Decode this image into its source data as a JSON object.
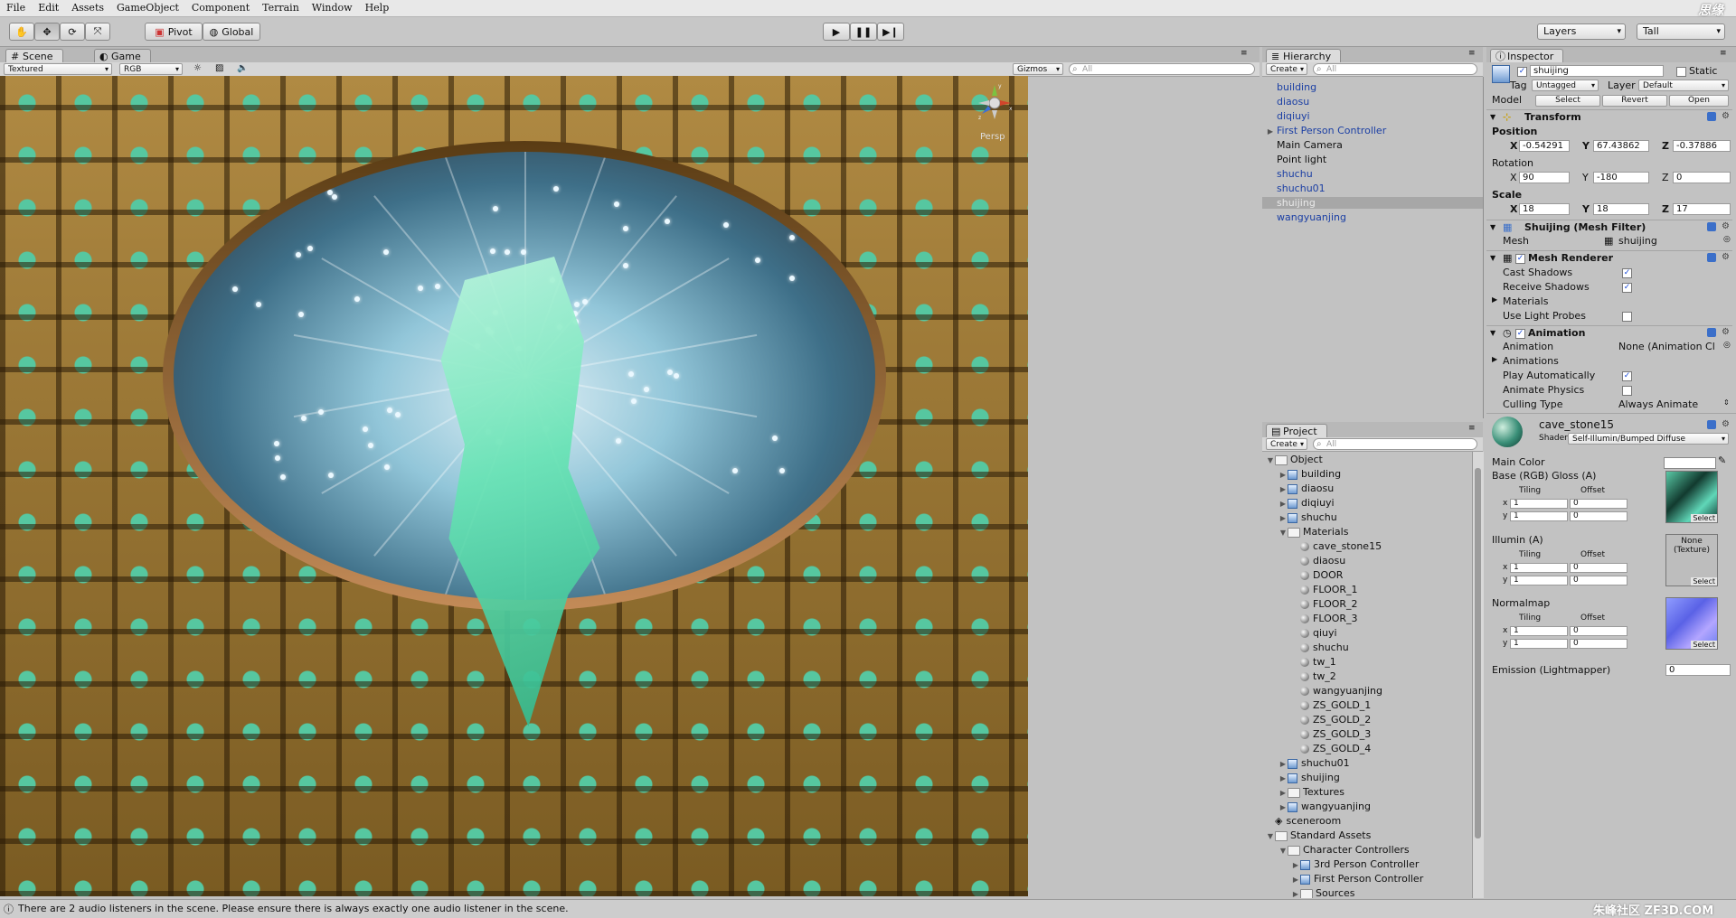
{
  "menubar": {
    "items": [
      "File",
      "Edit",
      "Assets",
      "GameObject",
      "Component",
      "Terrain",
      "Window",
      "Help"
    ],
    "watermark": "思缘"
  },
  "toolbar": {
    "pivot_label": "Pivot",
    "global_label": "Global",
    "layers_label": "Layers",
    "layout_label": "Tall"
  },
  "scene_panel": {
    "tab_scene": "Scene",
    "tab_game": "Game",
    "render_mode": "Textured",
    "color_mode": "RGB",
    "gizmos_label": "Gizmos",
    "search_placeholder": "All",
    "persp_label": "Persp",
    "gizmo_axis_y": "y",
    "gizmo_axis_x": "x",
    "gizmo_axis_z": "z"
  },
  "hierarchy": {
    "title": "Hierarchy",
    "create_label": "Create",
    "search_placeholder": "All",
    "items": [
      {
        "label": "building",
        "style": "blue",
        "expandable": false
      },
      {
        "label": "diaosu",
        "style": "blue",
        "expandable": false
      },
      {
        "label": "diqiuyi",
        "style": "blue",
        "expandable": false
      },
      {
        "label": "First Person Controller",
        "style": "blue",
        "expandable": true
      },
      {
        "label": "Main Camera",
        "style": "normal",
        "expandable": false
      },
      {
        "label": "Point light",
        "style": "normal",
        "expandable": false
      },
      {
        "label": "shuchu",
        "style": "blue",
        "expandable": false
      },
      {
        "label": "shuchu01",
        "style": "blue",
        "expandable": false
      },
      {
        "label": "shuijing",
        "style": "selected",
        "expandable": false
      },
      {
        "label": "wangyuanjing",
        "style": "blue",
        "expandable": false
      }
    ]
  },
  "project": {
    "title": "Project",
    "create_label": "Create",
    "search_placeholder": "All",
    "items": [
      {
        "label": "Object",
        "icon": "folder",
        "indent": 0,
        "arrow": "open"
      },
      {
        "label": "building",
        "icon": "prefab",
        "indent": 1,
        "arrow": "closed"
      },
      {
        "label": "diaosu",
        "icon": "prefab",
        "indent": 1,
        "arrow": "closed"
      },
      {
        "label": "diqiuyi",
        "icon": "prefab",
        "indent": 1,
        "arrow": "closed"
      },
      {
        "label": "shuchu",
        "icon": "prefab",
        "indent": 1,
        "arrow": "closed"
      },
      {
        "label": "Materials",
        "icon": "folder",
        "indent": 1,
        "arrow": "open"
      },
      {
        "label": "cave_stone15",
        "icon": "material",
        "indent": 2,
        "arrow": "none"
      },
      {
        "label": "diaosu",
        "icon": "material",
        "indent": 2,
        "arrow": "none"
      },
      {
        "label": "DOOR",
        "icon": "material",
        "indent": 2,
        "arrow": "none"
      },
      {
        "label": "FLOOR_1",
        "icon": "material",
        "indent": 2,
        "arrow": "none"
      },
      {
        "label": "FLOOR_2",
        "icon": "material",
        "indent": 2,
        "arrow": "none"
      },
      {
        "label": "FLOOR_3",
        "icon": "material",
        "indent": 2,
        "arrow": "none"
      },
      {
        "label": "qiuyi",
        "icon": "material",
        "indent": 2,
        "arrow": "none"
      },
      {
        "label": "shuchu",
        "icon": "material",
        "indent": 2,
        "arrow": "none"
      },
      {
        "label": "tw_1",
        "icon": "material",
        "indent": 2,
        "arrow": "none"
      },
      {
        "label": "tw_2",
        "icon": "material",
        "indent": 2,
        "arrow": "none"
      },
      {
        "label": "wangyuanjing",
        "icon": "material",
        "indent": 2,
        "arrow": "none"
      },
      {
        "label": "ZS_GOLD_1",
        "icon": "material",
        "indent": 2,
        "arrow": "none"
      },
      {
        "label": "ZS_GOLD_2",
        "icon": "material",
        "indent": 2,
        "arrow": "none"
      },
      {
        "label": "ZS_GOLD_3",
        "icon": "material",
        "indent": 2,
        "arrow": "none"
      },
      {
        "label": "ZS_GOLD_4",
        "icon": "material",
        "indent": 2,
        "arrow": "none"
      },
      {
        "label": "shuchu01",
        "icon": "prefab",
        "indent": 1,
        "arrow": "closed"
      },
      {
        "label": "shuijing",
        "icon": "prefab",
        "indent": 1,
        "arrow": "closed"
      },
      {
        "label": "Textures",
        "icon": "folder",
        "indent": 1,
        "arrow": "closed"
      },
      {
        "label": "wangyuanjing",
        "icon": "prefab",
        "indent": 1,
        "arrow": "closed"
      },
      {
        "label": "sceneroom",
        "icon": "unity",
        "indent": 0,
        "arrow": "none"
      },
      {
        "label": "Standard Assets",
        "icon": "folder",
        "indent": 0,
        "arrow": "open"
      },
      {
        "label": "Character Controllers",
        "icon": "folder",
        "indent": 1,
        "arrow": "open"
      },
      {
        "label": "3rd Person Controller",
        "icon": "prefab",
        "indent": 2,
        "arrow": "closed"
      },
      {
        "label": "First Person Controller",
        "icon": "prefab",
        "indent": 2,
        "arrow": "closed"
      },
      {
        "label": "Sources",
        "icon": "folder",
        "indent": 2,
        "arrow": "closed"
      }
    ]
  },
  "inspector": {
    "title": "Inspector",
    "object_name": "shuijing",
    "static_label": "Static",
    "tag_label": "Tag",
    "tag_value": "Untagged",
    "layer_label": "Layer",
    "layer_value": "Default",
    "model_label": "Model",
    "select_btn": "Select",
    "revert_btn": "Revert",
    "open_btn": "Open",
    "transform": {
      "title": "Transform",
      "position_label": "Position",
      "rotation_label": "Rotation",
      "scale_label": "Scale",
      "x_label": "X",
      "y_label": "Y",
      "z_label": "Z",
      "position": [
        "-0.54291",
        "67.43862",
        "-0.37886"
      ],
      "rotation": [
        "90",
        "-180",
        "0"
      ],
      "scale": [
        "18",
        "18",
        "17"
      ]
    },
    "mesh_filter": {
      "title": "Shuijing (Mesh Filter)",
      "mesh_label": "Mesh",
      "mesh_value": "shuijing"
    },
    "mesh_renderer": {
      "title": "Mesh Renderer",
      "cast_shadows": "Cast Shadows",
      "receive_shadows": "Receive Shadows",
      "materials": "Materials",
      "use_light_probes": "Use Light Probes"
    },
    "animation": {
      "title": "Animation",
      "animation_label": "Animation",
      "animation_value": "None (Animation Cl",
      "animations_label": "Animations",
      "play_auto": "Play Automatically",
      "animate_physics": "Animate Physics",
      "culling_type": "Culling Type",
      "culling_value": "Always Animate"
    },
    "material": {
      "name": "cave_stone15",
      "shader_label": "Shader",
      "shader_value": "Self-Illumin/Bumped Diffuse",
      "main_color": "Main Color",
      "base_label": "Base (RGB) Gloss (A)",
      "illum_label": "Illumin (A)",
      "normal_label": "Normalmap",
      "emission_label": "Emission (Lightmapper)",
      "emission_value": "0",
      "tiling_label": "Tiling",
      "offset_label": "Offset",
      "x_lbl": "x",
      "y_lbl": "y",
      "tiling_x": "1",
      "tiling_y": "1",
      "offset_x": "0",
      "offset_y": "0",
      "none_texture": "None\n(Texture)",
      "select_label": "Select"
    }
  },
  "statusbar": {
    "message": "There are 2 audio listeners in the scene. Please ensure there is always exactly one audio listener in the scene.",
    "watermark": "朱峰社区 ZF3D.COM"
  },
  "colors": {
    "selected_row": "#a7a7a7",
    "prefab_text": "#1b3fa4",
    "panel_bg": "#c2c2c2"
  }
}
